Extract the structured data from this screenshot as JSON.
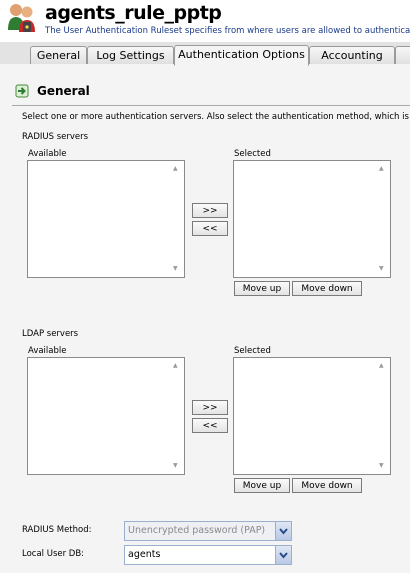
{
  "header": {
    "title": "agents_rule_pptp",
    "subtitle": "The User Authentication Ruleset specifies from where users are allowed to authenticate"
  },
  "tabs": [
    {
      "label": "General"
    },
    {
      "label": "Log Settings"
    },
    {
      "label": "Authentication Options",
      "active": true
    },
    {
      "label": "Accounting"
    }
  ],
  "section": {
    "title": "General",
    "description": "Select one or more authentication servers. Also select the authentication method, which is us"
  },
  "radius": {
    "heading": "RADIUS servers",
    "available_label": "Available",
    "selected_label": "Selected",
    "add_label": ">>",
    "remove_label": "<<",
    "move_up_label": "Move up",
    "move_down_label": "Move down"
  },
  "ldap": {
    "heading": "LDAP servers",
    "available_label": "Available",
    "selected_label": "Selected",
    "add_label": ">>",
    "remove_label": "<<",
    "move_up_label": "Move up",
    "move_down_label": "Move down"
  },
  "fields": {
    "radius_method_label": "RADIUS Method:",
    "radius_method_value": "Unencrypted password (PAP)",
    "local_user_db_label": "Local User DB:",
    "local_user_db_value": "agents"
  }
}
